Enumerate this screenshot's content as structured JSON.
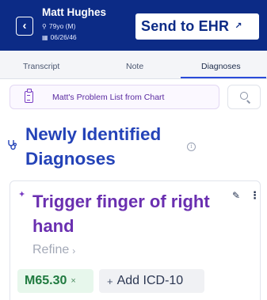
{
  "header": {
    "patient_name": "Matt Hughes",
    "age_sex": "79yo (M)",
    "dob": "06/26/46",
    "send_button_label": "Send to EHR",
    "back_icon": "chevron-left-icon",
    "background_color": "#0c2b86"
  },
  "tabs": [
    {
      "label": "Transcript",
      "active": false
    },
    {
      "label": "Note",
      "active": false
    },
    {
      "label": "Diagnoses",
      "active": true
    }
  ],
  "problem_list": {
    "label": "Matt's Problem List from Chart",
    "icon": "clipboard-icon"
  },
  "search": {
    "icon": "search-icon"
  },
  "section": {
    "title": "Newly Identified Diagnoses",
    "icon": "stethoscope-icon",
    "info_icon": "info-icon"
  },
  "diagnosis": {
    "title": "Trigger finger of right hand",
    "refine_label": "Refine",
    "icd_code": "M65.30",
    "add_icd_label": "Add ICD-10",
    "accent_color": "#6a2fb0",
    "chip_color": "#1f7a3f"
  }
}
